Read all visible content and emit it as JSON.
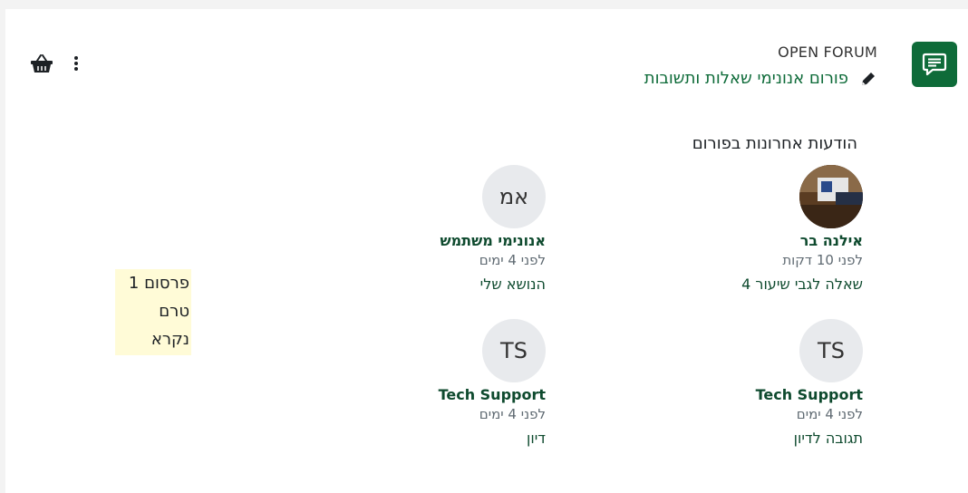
{
  "header": {
    "type_label": "OPEN FORUM",
    "title": "פורום אנונימי שאלות ותשובות",
    "icon": "forum-chat-icon",
    "accent_color": "#0e6b39"
  },
  "toolbar": {
    "basket_icon": "basket-icon",
    "menu_icon": "kebab-menu-icon"
  },
  "section": {
    "heading": "הודעות אחרונות בפורום"
  },
  "posts": [
    {
      "avatar_initials": "",
      "author": "אילנה בר",
      "time": "לפני 10 דקות",
      "subject": "שאלה לגבי שיעור 4"
    },
    {
      "avatar_initials": "אמ",
      "author": "אנונימי משתמש",
      "time": "לפני 4 ימים",
      "subject": "הנושא שלי"
    },
    {
      "avatar_initials": "TS",
      "author": "Tech Support",
      "time": "לפני 4 ימים",
      "subject": "תגובה לדיון"
    },
    {
      "avatar_initials": "TS",
      "author": "Tech Support",
      "time": "לפני 4 ימים",
      "subject": "דיון"
    }
  ],
  "unread_notice": {
    "line1": "פרסום 1",
    "line2": "טרם",
    "line3": "נקרא"
  }
}
